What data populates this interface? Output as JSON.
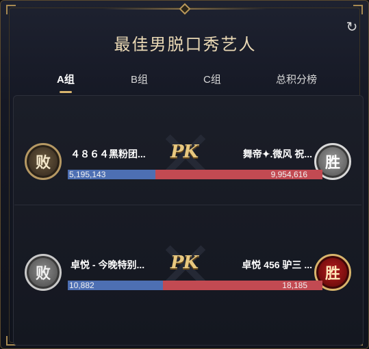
{
  "title": "最佳男脱口秀艺人",
  "tabs": [
    {
      "label": "A组"
    },
    {
      "label": "B组"
    },
    {
      "label": "C组"
    },
    {
      "label": "总积分榜"
    }
  ],
  "icons": {
    "refresh": "refresh-icon"
  },
  "pk_label": "PK",
  "matches": [
    {
      "left": {
        "name": "４８６４黑粉团...",
        "score": "5,195,143",
        "badge": "败"
      },
      "right": {
        "name": "舞帝✦.微风 祝...",
        "score": "9,954,616",
        "badge": "胜"
      },
      "left_share": 0.343
    },
    {
      "left": {
        "name": "卓悦 - 今晚特别...",
        "score": "10,882",
        "badge": "败"
      },
      "right": {
        "name": "卓悦 456 驴三 ...",
        "score": "18,185",
        "badge": "胜"
      },
      "left_share": 0.374
    }
  ],
  "colors": {
    "left_bar": "#4d6fb3",
    "right_bar": "#c24a52",
    "accent": "#d9b56e"
  }
}
